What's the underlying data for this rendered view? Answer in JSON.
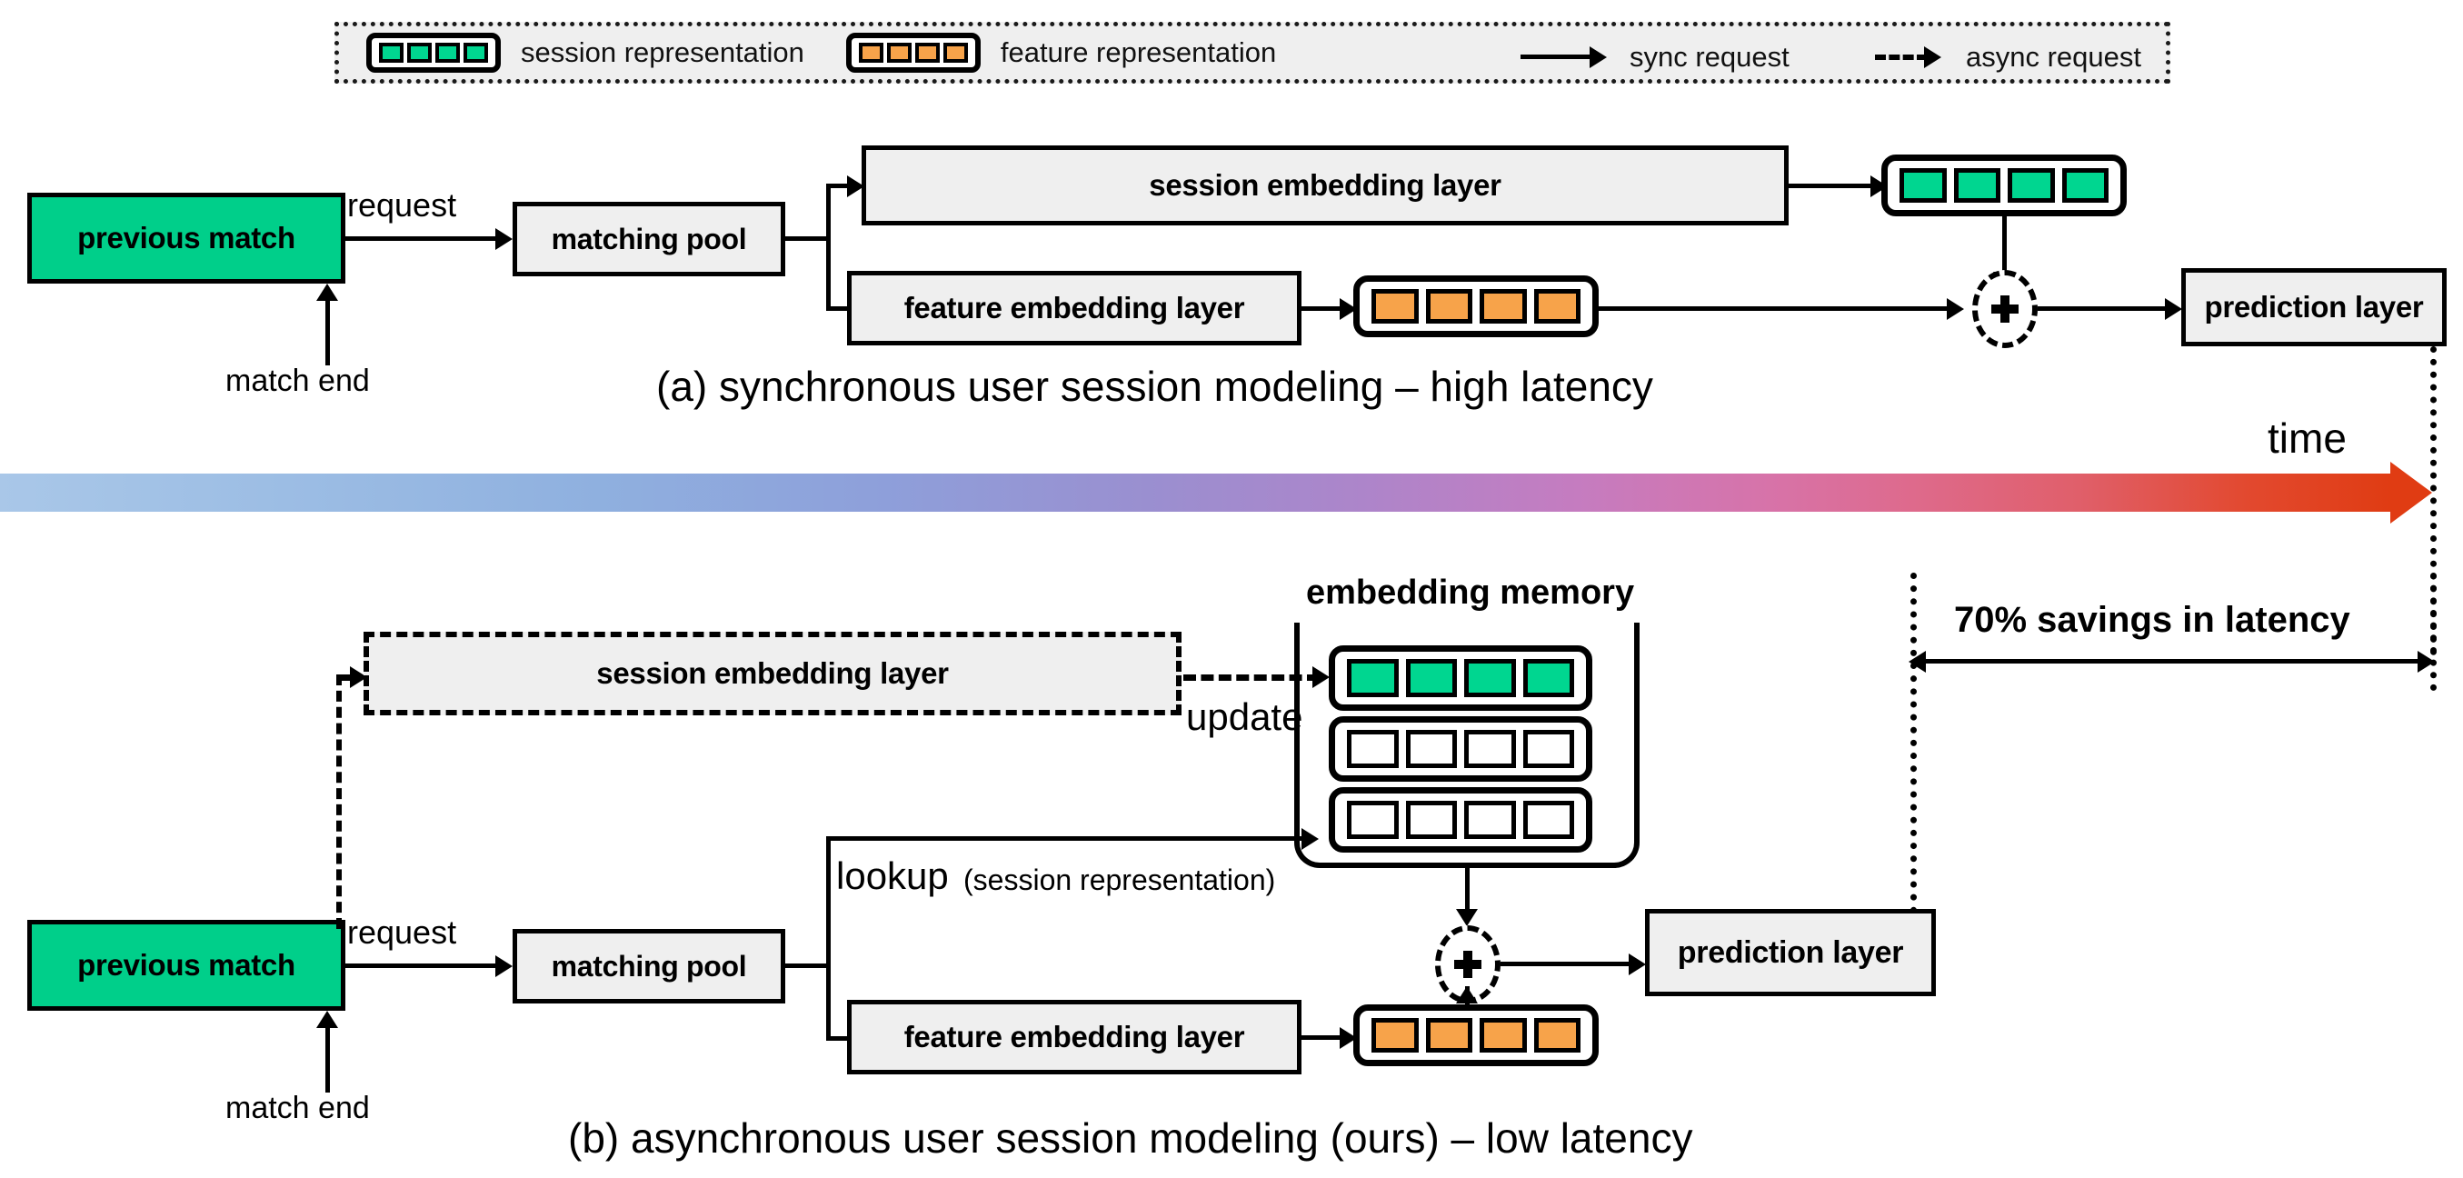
{
  "legend": {
    "items": [
      {
        "icon": "session-representation-chip",
        "label": "session representation",
        "color": "#00d690"
      },
      {
        "icon": "feature-representation-chip",
        "label": "feature representation",
        "color": "#f7a34a"
      },
      {
        "icon": "solid-arrow",
        "label": "sync request"
      },
      {
        "icon": "dashed-arrow",
        "label": "async request"
      }
    ]
  },
  "panel_a": {
    "caption": "(a) synchronous user session modeling – high latency",
    "previous_match": "previous match",
    "match_end": "match end",
    "request": "request",
    "matching_pool": "matching pool",
    "session_embedding_layer": "session embedding layer",
    "feature_embedding_layer": "feature embedding layer",
    "prediction_layer": "prediction layer",
    "plus": "+"
  },
  "timeline": {
    "label": "time",
    "savings_label": "70% savings in latency",
    "gradient_start": "#a9c7e8",
    "gradient_end": "#e03c13"
  },
  "panel_b": {
    "caption": "(b) asynchronous user session modeling (ours) – low latency",
    "previous_match": "previous match",
    "match_end": "match end",
    "request": "request",
    "matching_pool": "matching pool",
    "session_embedding_layer": "session embedding layer",
    "feature_embedding_layer": "feature embedding layer",
    "prediction_layer": "prediction layer",
    "embedding_memory": "embedding memory",
    "update": "update",
    "lookup": "lookup",
    "lookup_paren": "(session representation)",
    "plus": "+"
  },
  "colors": {
    "green": "#00cf8a",
    "chip_green": "#00d690",
    "orange": "#f7a34a",
    "box_fill": "#efefef",
    "stroke": "#000000"
  }
}
